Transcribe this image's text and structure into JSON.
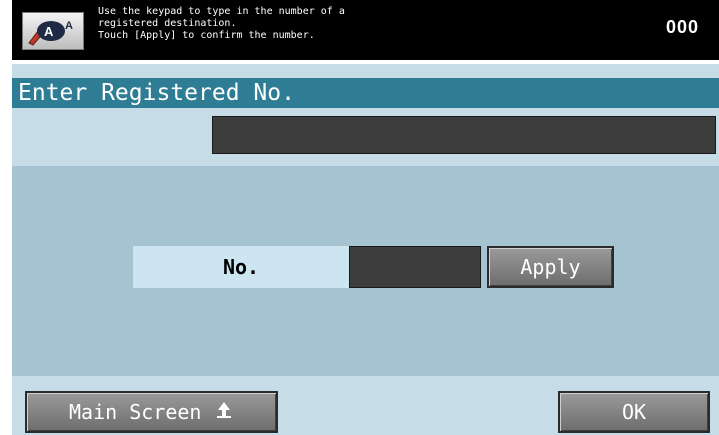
{
  "header": {
    "help_icon": "help-icon",
    "message": "Use the keypad to type in the number of a\nregistered destination.\nTouch [Apply] to confirm the number.",
    "counter": "000"
  },
  "screen": {
    "title": "Enter Registered No.",
    "registered_field_value": ""
  },
  "entry": {
    "label": "No.",
    "value": "",
    "apply_label": "Apply"
  },
  "footer": {
    "main_screen_label": "Main Screen",
    "main_screen_icon": "arrow-up-icon",
    "ok_label": "OK"
  },
  "colors": {
    "title_bar": "#2f7d94",
    "panel": "#c6dde8",
    "inner_area": "#a6c3d2"
  }
}
